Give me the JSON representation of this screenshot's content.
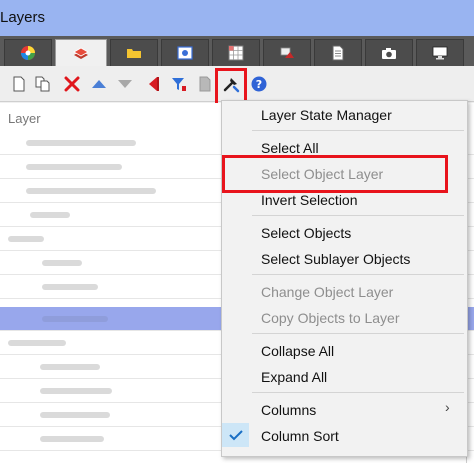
{
  "window": {
    "title": "Layers"
  },
  "tabs": [
    {
      "icon": "color-wheel-icon"
    },
    {
      "icon": "layer-stack-icon",
      "active": true
    },
    {
      "icon": "folder-icon"
    },
    {
      "icon": "image-icon"
    },
    {
      "icon": "grid-icon"
    },
    {
      "icon": "shapes-icon"
    },
    {
      "icon": "document-icon"
    },
    {
      "icon": "camera-icon"
    },
    {
      "icon": "monitor-icon"
    }
  ],
  "toolbar": {
    "icons": [
      "new-layer-icon",
      "new-sublayer-icon",
      "delete-icon",
      "move-up-icon",
      "move-down-icon",
      "set-current-icon",
      "filter-icon",
      "copy-icon",
      "tools-icon",
      "help-icon"
    ]
  },
  "list": {
    "column_header": "Layer"
  },
  "menu": {
    "layer_state_manager": "Layer State Manager",
    "select_all": "Select All",
    "select_object_layer": "Select Object Layer",
    "invert_selection": "Invert Selection",
    "select_objects": "Select Objects",
    "select_sublayer_objects": "Select Sublayer Objects",
    "change_object_layer": "Change Object Layer",
    "copy_objects_to_layer": "Copy Objects to Layer",
    "collapse_all": "Collapse All",
    "expand_all": "Expand All",
    "columns": "Columns",
    "column_sort": "Column Sort",
    "columns_arrow": "›"
  },
  "colors": {
    "highlight_red": "#e8141c",
    "selected_row": "#98a7ec",
    "title_bar": "#99b4f1"
  }
}
